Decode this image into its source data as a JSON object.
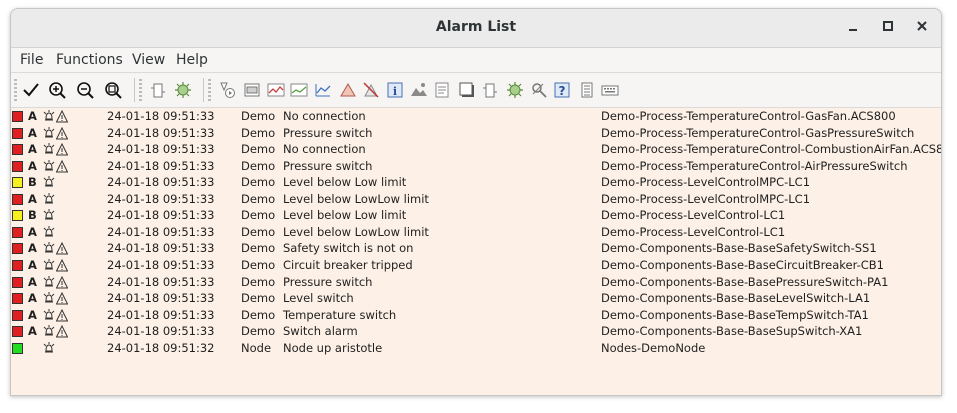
{
  "window": {
    "title": "Alarm List",
    "minimize": "_",
    "maximize": "□",
    "close": "✕"
  },
  "menu": [
    "File",
    "Functions",
    "View",
    "Help"
  ],
  "toolbar_icons": [
    "check-icon",
    "zoom-in-icon",
    "zoom-out-icon",
    "zoom-reset-icon",
    "object-icon",
    "component-icon",
    "open-plc-icon",
    "object-graph-icon",
    "trend-icon",
    "history-icon",
    "fast-curve-icon",
    "alarm-triangle-icon",
    "block-events-icon",
    "info-icon",
    "photo-icon",
    "notes-icon",
    "graph-icon",
    "object-plain-icon",
    "crossref-icon",
    "help-search-icon",
    "help-icon",
    "datasheet-icon",
    "keyboard-icon"
  ],
  "colors": {
    "A": "#e02020",
    "B": "#f5f020",
    "Info": "#22dd22",
    "listBg": "#fdf0e6"
  },
  "alarms": [
    {
      "color": "A",
      "prio": "A",
      "warn": true,
      "time": "24-01-18 09:51:33",
      "group": "Demo",
      "text": "No connection",
      "object": "Demo-Process-TemperatureControl-GasFan.ACS800"
    },
    {
      "color": "A",
      "prio": "A",
      "warn": true,
      "time": "24-01-18 09:51:33",
      "group": "Demo",
      "text": "Pressure switch",
      "object": "Demo-Process-TemperatureControl-GasPressureSwitch"
    },
    {
      "color": "A",
      "prio": "A",
      "warn": true,
      "time": "24-01-18 09:51:33",
      "group": "Demo",
      "text": "No connection",
      "object": "Demo-Process-TemperatureControl-CombustionAirFan.ACS8"
    },
    {
      "color": "A",
      "prio": "A",
      "warn": true,
      "time": "24-01-18 09:51:33",
      "group": "Demo",
      "text": "Pressure switch",
      "object": "Demo-Process-TemperatureControl-AirPressureSwitch"
    },
    {
      "color": "B",
      "prio": "B",
      "warn": false,
      "time": "24-01-18 09:51:33",
      "group": "Demo",
      "text": "Level below Low limit",
      "object": "Demo-Process-LevelControlMPC-LC1"
    },
    {
      "color": "A",
      "prio": "A",
      "warn": false,
      "time": "24-01-18 09:51:33",
      "group": "Demo",
      "text": "Level below LowLow limit",
      "object": "Demo-Process-LevelControlMPC-LC1"
    },
    {
      "color": "B",
      "prio": "B",
      "warn": false,
      "time": "24-01-18 09:51:33",
      "group": "Demo",
      "text": "Level below Low limit",
      "object": "Demo-Process-LevelControl-LC1"
    },
    {
      "color": "A",
      "prio": "A",
      "warn": false,
      "time": "24-01-18 09:51:33",
      "group": "Demo",
      "text": "Level below LowLow limit",
      "object": "Demo-Process-LevelControl-LC1"
    },
    {
      "color": "A",
      "prio": "A",
      "warn": true,
      "time": "24-01-18 09:51:33",
      "group": "Demo",
      "text": "Safety switch is not on",
      "object": "Demo-Components-Base-BaseSafetySwitch-SS1"
    },
    {
      "color": "A",
      "prio": "A",
      "warn": true,
      "time": "24-01-18 09:51:33",
      "group": "Demo",
      "text": "Circuit breaker tripped",
      "object": "Demo-Components-Base-BaseCircuitBreaker-CB1"
    },
    {
      "color": "A",
      "prio": "A",
      "warn": true,
      "time": "24-01-18 09:51:33",
      "group": "Demo",
      "text": "Pressure switch",
      "object": "Demo-Components-Base-BasePressureSwitch-PA1"
    },
    {
      "color": "A",
      "prio": "A",
      "warn": true,
      "time": "24-01-18 09:51:33",
      "group": "Demo",
      "text": "Level switch",
      "object": "Demo-Components-Base-BaseLevelSwitch-LA1"
    },
    {
      "color": "A",
      "prio": "A",
      "warn": true,
      "time": "24-01-18 09:51:33",
      "group": "Demo",
      "text": "Temperature switch",
      "object": "Demo-Components-Base-BaseTempSwitch-TA1"
    },
    {
      "color": "A",
      "prio": "A",
      "warn": true,
      "time": "24-01-18 09:51:33",
      "group": "Demo",
      "text": "Switch alarm",
      "object": "Demo-Components-Base-BaseSupSwitch-XA1"
    },
    {
      "color": "Info",
      "prio": "",
      "warn": false,
      "time": "24-01-18 09:51:32",
      "group": "Node",
      "text": "Node up aristotle",
      "object": "Nodes-DemoNode"
    }
  ]
}
